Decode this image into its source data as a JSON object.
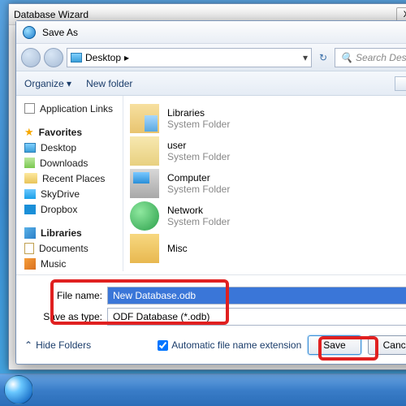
{
  "outer_window_title": "Database Wizard",
  "dialog_title": "Save As",
  "path": {
    "root": "Desktop",
    "chevron": "▸"
  },
  "search_placeholder": "Search Desktop",
  "toolbar": {
    "organize": "Organize ▾",
    "new_folder": "New folder"
  },
  "sidebar": {
    "app_links": "Application Links",
    "favorites": "Favorites",
    "fav_items": [
      "Desktop",
      "Downloads",
      "Recent Places",
      "SkyDrive",
      "Dropbox"
    ],
    "libraries": "Libraries",
    "lib_items": [
      "Documents",
      "Music"
    ]
  },
  "content": {
    "sub": "System Folder",
    "items": [
      "Libraries",
      "user",
      "Computer",
      "Network",
      "Misc"
    ]
  },
  "fields": {
    "fn_label": "File name:",
    "fn_value": "New Database.odb",
    "type_label": "Save as type:",
    "type_value": "ODF Database (*.odb)"
  },
  "footer": {
    "hide": "Hide Folders",
    "auto": "Automatic file name extension",
    "save": "Save",
    "cancel": "Cancel"
  }
}
